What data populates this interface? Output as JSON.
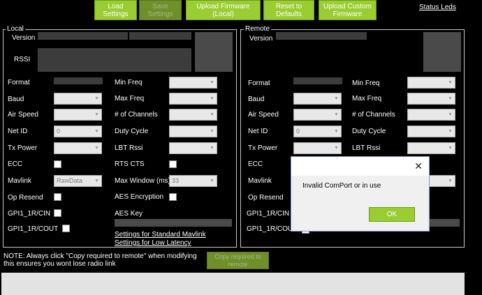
{
  "toolbar": {
    "load_settings": "Load\nSettings",
    "save_settings": "Save\nSettings",
    "upload_firmware_local": "Upload Firmware\n(Local)",
    "reset_defaults": "Reset to\nDefaults",
    "upload_custom_firmware": "Upload Custom\nFirmware",
    "status_leds": "Status Leds"
  },
  "local": {
    "title": "Local",
    "version_label": "Version",
    "rssi_label": "RSSI",
    "format_label": "Format",
    "baud_label": "Baud",
    "air_speed_label": "Air Speed",
    "net_id_label": "Net ID",
    "net_id_value": "0",
    "tx_power_label": "Tx Power",
    "ecc_label": "ECC",
    "mavlink_label": "Mavlink",
    "mavlink_value": "RawData",
    "op_resend_label": "Op Resend",
    "gpi_cin_label": "GPI1_1R/CIN",
    "gpi_cout_label": "GPI1_1R/COUT",
    "min_freq_label": "Min Freq",
    "max_freq_label": "Max Freq",
    "channels_label": "# of Channels",
    "duty_cycle_label": "Duty Cycle",
    "lbt_rssi_label": "LBT Rssi",
    "rts_cts_label": "RTS CTS",
    "max_window_label": "Max Window (ms)",
    "max_window_value": "33",
    "aes_encryption_label": "AES Encryption",
    "aes_key_label": "AES Key",
    "link_standard": "Settings for Standard Mavlink",
    "link_low_latency": "Settings for Low Latency"
  },
  "remote": {
    "title": "Remote",
    "version_label": "Version",
    "format_label": "Format",
    "baud_label": "Baud",
    "air_speed_label": "Air Speed",
    "net_id_label": "Net ID",
    "net_id_value": "0",
    "tx_power_label": "Tx Power",
    "ecc_label": "ECC",
    "mavlink_label": "Mavlink",
    "op_resend_label": "Op Resend",
    "gpi_cin_label": "GPI1_1R/CIN",
    "gpi_cout_label": "GPI1_1R/COUT",
    "min_freq_label": "Min Freq",
    "max_freq_label": "Max Freq",
    "channels_label": "# of Channels",
    "duty_cycle_label": "Duty Cycle",
    "lbt_rssi_label": "LBT Rssi"
  },
  "note": "NOTE: Always click \"Copy required to remote\" when modifying this ensures you wont lose radio link",
  "copy_button": "Copy required to remote",
  "dialog": {
    "message": "Invalid ComPort or in use",
    "ok": "OK",
    "close_glyph": "✕"
  },
  "combo_arrow": "▼"
}
